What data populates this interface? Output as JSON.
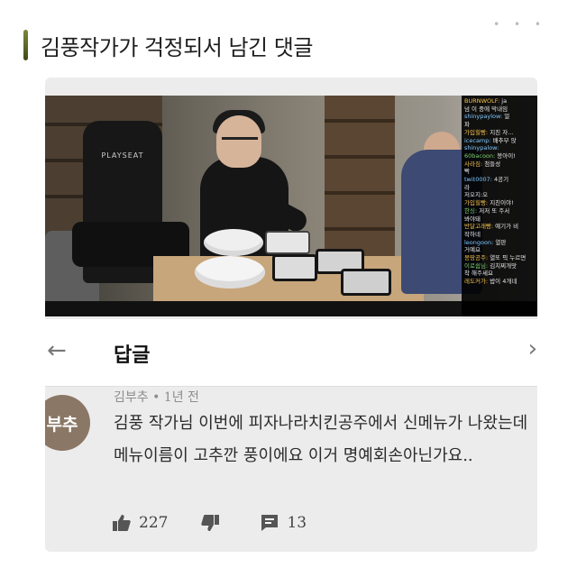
{
  "post": {
    "title": "김풍작가가 걱정되서 남긴 댓글"
  },
  "video": {
    "chair_brand": "PLAYSEAT",
    "chat": [
      {
        "user": "BURNWOLF",
        "text": "ja",
        "color": "y"
      },
      {
        "user": "",
        "text": "넘 이 중에 막내임",
        "color": ""
      },
      {
        "user": "shinypaylow",
        "text": "얼",
        "color": "c"
      },
      {
        "user": "",
        "text": "파",
        "color": ""
      },
      {
        "user": "가입힐빵",
        "text": "지친 자…",
        "color": "y"
      },
      {
        "user": "icecamp",
        "text": "배추부 앉",
        "color": "c"
      },
      {
        "user": "shinypalow",
        "text": "",
        "color": "c"
      },
      {
        "user": "60bacoon",
        "text": "봉아이!",
        "color": "g"
      },
      {
        "user": "사라짐",
        "text": "첨들성",
        "color": "y"
      },
      {
        "user": "",
        "text": "빡",
        "color": ""
      },
      {
        "user": "twit0007",
        "text": "4공기",
        "color": "c"
      },
      {
        "user": "",
        "text": "라",
        "color": ""
      },
      {
        "user": "",
        "text": "저오지:오",
        "color": ""
      },
      {
        "user": "가입힐빵",
        "text": "지친이야!",
        "color": "y"
      },
      {
        "user": "한싱",
        "text": "저저 또 주서",
        "color": "g"
      },
      {
        "user": "",
        "text": "봐야돼",
        "color": ""
      },
      {
        "user": "반달고래빵",
        "text": "얘기가 비",
        "color": "y"
      },
      {
        "user": "",
        "text": "작하네",
        "color": ""
      },
      {
        "user": "leongoon",
        "text": "열판",
        "color": "c"
      },
      {
        "user": "",
        "text": "거예요",
        "color": ""
      },
      {
        "user": "몽땅공주",
        "text": "열또 픽 누르면",
        "color": "y"
      },
      {
        "user": "이로쉽님",
        "text": "김치찌개맛",
        "color": "g"
      },
      {
        "user": "",
        "text": "착 해주세요",
        "color": ""
      },
      {
        "user": "레도커가",
        "text": "밥이 4개네",
        "color": "y"
      }
    ]
  },
  "reply_bar": {
    "back_glyph": "←",
    "title": "답글",
    "next_glyph": "›"
  },
  "comment": {
    "avatar_text": "부추",
    "meta": "김부추 • 1년 전",
    "text": "김풍 작가님 이번에 피자나라치킨공주에서 신메뉴가 나왔는데 메뉴이름이 고추깐 풍이에요 이거 명예회손아닌가요..",
    "likes": "227",
    "replies": "13"
  }
}
